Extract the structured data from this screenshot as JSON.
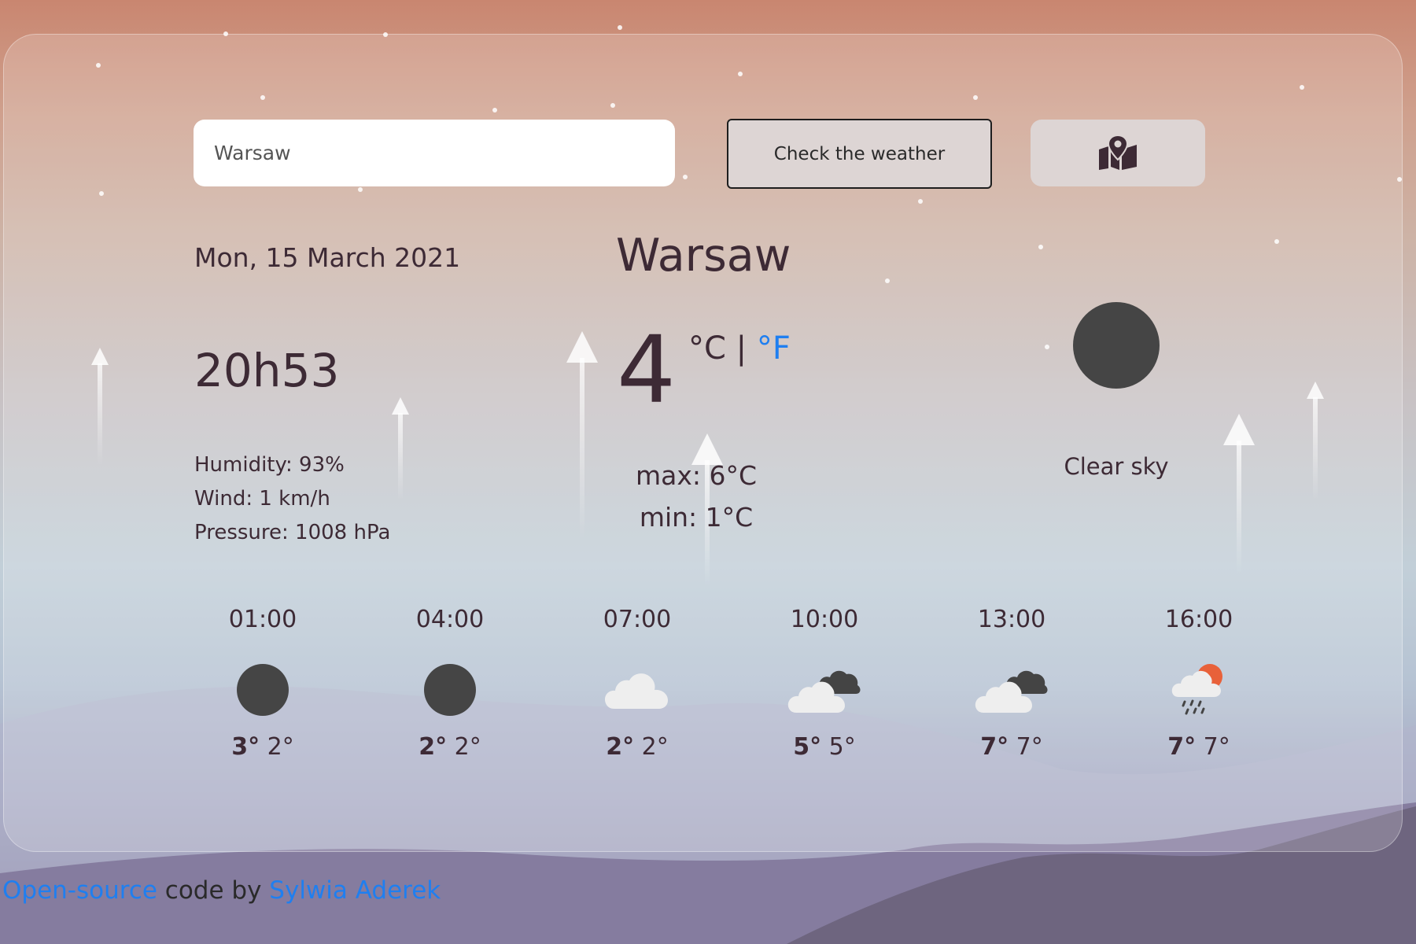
{
  "search": {
    "value": "Warsaw",
    "button_label": "Check the weather",
    "map_icon": "map-pin-icon"
  },
  "current": {
    "date": "Mon, 15 March 2021",
    "time": "20h53",
    "city": "Warsaw",
    "temperature": "4",
    "unit_celsius": "°C",
    "unit_separator": "|",
    "unit_fahrenheit": "°F",
    "humidity": "Humidity: 93%",
    "wind": "Wind: 1 km/h",
    "pressure": "Pressure: 1008 hPa",
    "max": "max: 6°C",
    "min": "min: 1°C",
    "description": "Clear sky",
    "icon": "moon-icon"
  },
  "forecast": [
    {
      "time": "01:00",
      "hi": "3°",
      "lo": "2°",
      "icon": "moon-icon"
    },
    {
      "time": "04:00",
      "hi": "2°",
      "lo": "2°",
      "icon": "moon-icon"
    },
    {
      "time": "07:00",
      "hi": "2°",
      "lo": "2°",
      "icon": "cloud-icon"
    },
    {
      "time": "10:00",
      "hi": "5°",
      "lo": "5°",
      "icon": "dark-clouds-icon"
    },
    {
      "time": "13:00",
      "hi": "7°",
      "lo": "7°",
      "icon": "dark-clouds-icon"
    },
    {
      "time": "16:00",
      "hi": "7°",
      "lo": "7°",
      "icon": "rain-sun-icon"
    }
  ],
  "footer": {
    "link1": "Open-source",
    "middle": " code by ",
    "link2": "Sylwia Aderek"
  },
  "colors": {
    "text": "#3d2a35",
    "link": "#1f7ff0",
    "button_bg": "#ddd5d4",
    "moon": "#454545",
    "sun": "#e8613a"
  }
}
